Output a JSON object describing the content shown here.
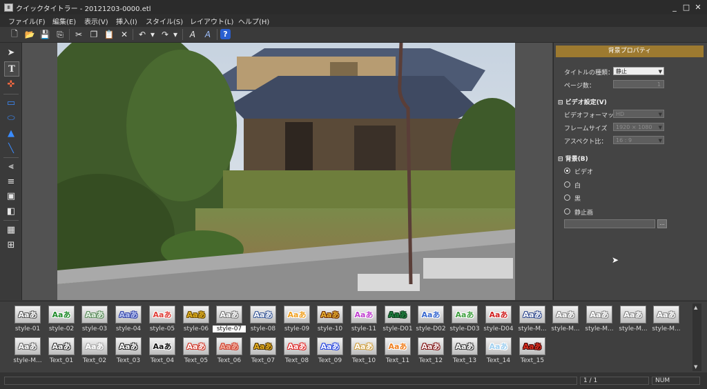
{
  "window": {
    "title": "クイックタイトラー - 20121203-0000.etl",
    "app_icon": "app-icon",
    "controls": {
      "minimize": "_",
      "maximize": "□",
      "close": "✕"
    }
  },
  "menu": [
    {
      "label": "ファイル(F)"
    },
    {
      "label": "編集(E)"
    },
    {
      "label": "表示(V)"
    },
    {
      "label": "挿入(I)"
    },
    {
      "label": "スタイル(S)"
    },
    {
      "label": "レイアウト(L)"
    },
    {
      "label": "ヘルプ(H)"
    }
  ],
  "toolbar": [
    {
      "icon": "new-file-icon",
      "glyph": "🗋"
    },
    {
      "icon": "open-icon",
      "glyph": "📂"
    },
    {
      "icon": "save-icon",
      "glyph": "💾"
    },
    {
      "icon": "save-all-icon",
      "glyph": "⎘"
    },
    {
      "icon": "cut-icon",
      "glyph": "✂"
    },
    {
      "icon": "copy-icon",
      "glyph": "❐"
    },
    {
      "icon": "paste-icon",
      "glyph": "📋"
    },
    {
      "icon": "delete-icon",
      "glyph": "✕"
    },
    {
      "icon": "undo-icon",
      "glyph": "↶"
    },
    {
      "icon": "undo-dropdown-icon",
      "glyph": "▾"
    },
    {
      "icon": "redo-icon",
      "glyph": "↷"
    },
    {
      "icon": "redo-dropdown-icon",
      "glyph": "▾"
    },
    {
      "icon": "text-style-icon",
      "glyph": "A"
    },
    {
      "icon": "text-effect-icon",
      "glyph": "A"
    },
    {
      "icon": "help-icon",
      "glyph": "?"
    }
  ],
  "tools": [
    {
      "icon": "select-arrow-icon",
      "glyph": "➤"
    },
    {
      "icon": "text-tool-icon",
      "glyph": "T"
    },
    {
      "icon": "crop-tool-icon",
      "glyph": "✜"
    },
    {
      "icon": "rectangle-tool-icon",
      "glyph": "▭"
    },
    {
      "icon": "ellipse-tool-icon",
      "glyph": "⬭"
    },
    {
      "icon": "triangle-tool-icon",
      "glyph": "▲"
    },
    {
      "icon": "line-tool-icon",
      "glyph": "╲"
    },
    {
      "icon": "align-left-icon",
      "glyph": "⫷"
    },
    {
      "icon": "align-center-icon",
      "glyph": "≡"
    },
    {
      "icon": "frame-icon",
      "glyph": "▣"
    },
    {
      "icon": "layer-icon",
      "glyph": "◧"
    },
    {
      "icon": "grid-icon",
      "glyph": "▦"
    },
    {
      "icon": "table-icon",
      "glyph": "⊞"
    }
  ],
  "panel": {
    "header": "背景プロパティ",
    "title_type_label": "タイトルの種類：",
    "title_type_value": "静止",
    "page_count_label": "ページ数：",
    "page_count_value": "1",
    "video_section": "ビデオ設定(V)",
    "video_format_label": "ビデオフォーマット",
    "video_format_value": "HD",
    "frame_size_label": "フレームサイズ",
    "frame_size_value": "1920 × 1080",
    "aspect_label": "アスペクト比：",
    "aspect_value": "16 : 9",
    "background_section": "背景(B)",
    "options": [
      {
        "label": "ビデオ",
        "selected": true
      },
      {
        "label": "白",
        "selected": false
      },
      {
        "label": "黒",
        "selected": false
      },
      {
        "label": "静止画",
        "selected": false
      }
    ],
    "browse_label": "..."
  },
  "gallery": {
    "row1": [
      {
        "label": "style-01",
        "text": "Aaあ",
        "color": "#ffffff",
        "outline": "#555555"
      },
      {
        "label": "style-02",
        "text": "Aaあ",
        "color": "#1f8a2a",
        "outline": "#ffffff"
      },
      {
        "label": "style-03",
        "text": "Aaあ",
        "color": "#e8f4e8",
        "outline": "#5a8a5a"
      },
      {
        "label": "style-04",
        "text": "Aaあ",
        "color": "#b8c4f0",
        "outline": "#3344aa"
      },
      {
        "label": "style-05",
        "text": "Aaあ",
        "color": "#e0403a",
        "outline": "#ffffff"
      },
      {
        "label": "style-06",
        "text": "Aaあ",
        "color": "#e0b020",
        "outline": "#6a4a00"
      },
      {
        "label": "style-07",
        "text": "Aaあ",
        "color": "#ffffff",
        "outline": "#777777"
      },
      {
        "label": "style-08",
        "text": "Aaあ",
        "color": "#ffffff",
        "outline": "#3a5a9a"
      },
      {
        "label": "style-09",
        "text": "Aaあ",
        "color": "#f0a020",
        "outline": "#ffffff"
      },
      {
        "label": "style-10",
        "text": "Aaあ",
        "color": "#e8b030",
        "outline": "#6a2a00"
      },
      {
        "label": "style-11",
        "text": "Aaあ",
        "color": "#c040d0",
        "outline": "#ffffff"
      },
      {
        "label": "style-D01",
        "text": "Aaあ",
        "color": "#208040",
        "outline": "#0a3a1a"
      },
      {
        "label": "style-D02",
        "text": "Aaあ",
        "color": "#3a6ad0",
        "outline": "#ffffff"
      },
      {
        "label": "style-D03",
        "text": "Aaあ",
        "color": "#40a040",
        "outline": "#ffffff"
      },
      {
        "label": "style-D04",
        "text": "Aaあ",
        "color": "#d02020",
        "outline": "#ffffff"
      },
      {
        "label": "style-M...",
        "text": "Aaあ",
        "color": "#ffffff",
        "outline": "#304a90"
      },
      {
        "label": "style-M...",
        "text": "Aaあ",
        "color": "#ffffff",
        "outline": "#888888"
      },
      {
        "label": "style-M...",
        "text": "Aaあ",
        "color": "#ffffff",
        "outline": "#888888"
      },
      {
        "label": "style-M...",
        "text": "Aaあ",
        "color": "#ffffff",
        "outline": "#888888"
      },
      {
        "label": "style-M...",
        "text": "Aaあ",
        "color": "#ffffff",
        "outline": "#888888"
      }
    ],
    "row2": [
      {
        "label": "style-M...",
        "text": "Aaあ",
        "color": "#ffffff",
        "outline": "#666666"
      },
      {
        "label": "Text_01",
        "text": "Aaあ",
        "color": "#ffffff",
        "outline": "#333333"
      },
      {
        "label": "Text_02",
        "text": "Aaあ",
        "color": "#ffffff",
        "outline": "#aaaaaa"
      },
      {
        "label": "Text_03",
        "text": "Aaあ",
        "color": "#ffffff",
        "outline": "#222222"
      },
      {
        "label": "Text_04",
        "text": "Aaあ",
        "color": "#111111",
        "outline": "#ffffff"
      },
      {
        "label": "Text_05",
        "text": "Aaあ",
        "color": "#ffffff",
        "outline": "#d03020"
      },
      {
        "label": "Text_06",
        "text": "Aaあ",
        "color": "#f0b0a0",
        "outline": "#d04030"
      },
      {
        "label": "Text_07",
        "text": "Aaあ",
        "color": "#e8b020",
        "outline": "#4a3000"
      },
      {
        "label": "Text_08",
        "text": "Aaあ",
        "color": "#ffffff",
        "outline": "#e02020"
      },
      {
        "label": "Text_09",
        "text": "Aaあ",
        "color": "#ffffff",
        "outline": "#2040e0"
      },
      {
        "label": "Text_10",
        "text": "Aaあ",
        "color": "#ffffff",
        "outline": "#d0a040"
      },
      {
        "label": "Text_11",
        "text": "Aaあ",
        "color": "#f08020",
        "outline": "#ffffff"
      },
      {
        "label": "Text_12",
        "text": "Aaあ",
        "color": "#ffffff",
        "outline": "#801010"
      },
      {
        "label": "Text_13",
        "text": "Aaあ",
        "color": "#ffffff",
        "outline": "#3a3a3a"
      },
      {
        "label": "Text_14",
        "text": "Aaあ",
        "color": "#a0d0f0",
        "outline": "#ffffff"
      },
      {
        "label": "Text_15",
        "text": "Aaあ",
        "color": "#e03020",
        "outline": "#400000"
      }
    ],
    "selected_label": "style-07"
  },
  "status": {
    "page": "1 / 1",
    "num": "NUM"
  }
}
